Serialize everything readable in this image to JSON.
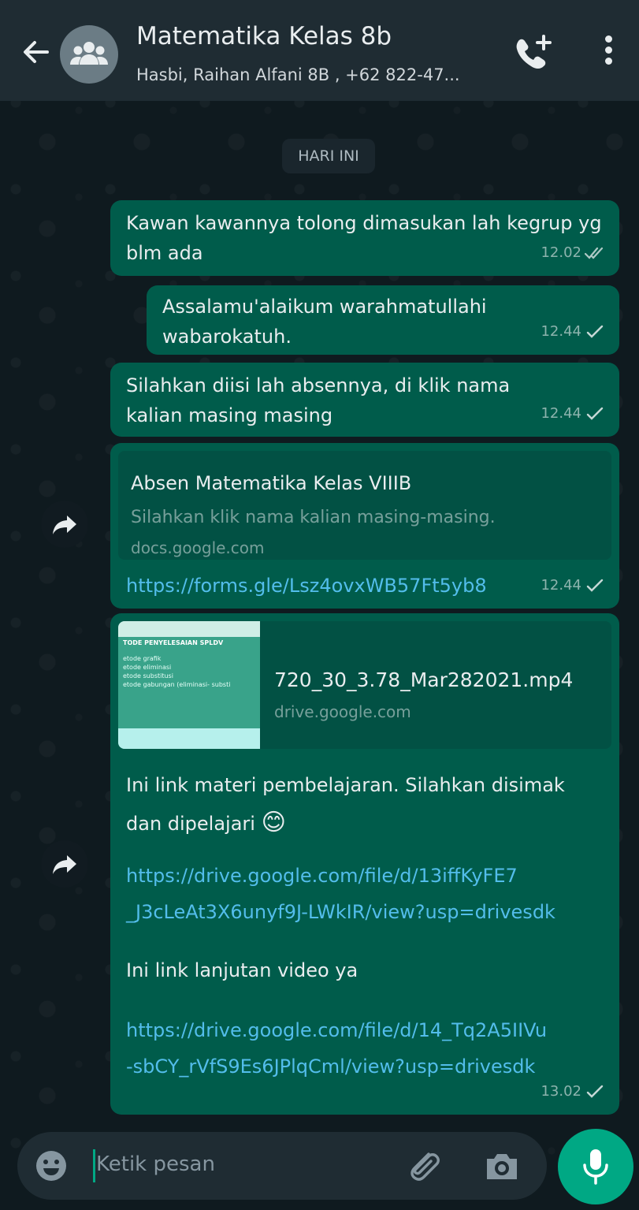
{
  "header": {
    "title": "Matematika Kelas 8b",
    "subtitle": "Hasbi, Raihan Alfani 8B , +62 822-47..."
  },
  "date_divider": "HARI INI",
  "messages": [
    {
      "text": "Kawan kawannya tolong dimasukan lah kegrup yg blm ada",
      "time": "12.02",
      "status": "read"
    },
    {
      "text": "Assalamu'alaikum warahmatullahi wabarokatuh.",
      "time": "12.44",
      "status": "sent"
    },
    {
      "text": "Silahkan diisi lah absennya, di klik nama kalian masing masing",
      "time": "12.44",
      "status": "sent"
    },
    {
      "preview_title": "Absen Matematika Kelas VIIIB",
      "preview_desc": "Silahkan klik nama kalian masing-masing.",
      "preview_domain": "docs.google.com",
      "link": "https://forms.gle/Lsz4ovxWB57Ft5yb8",
      "time": "12.44",
      "status": "sent"
    },
    {
      "file_name": "720_30_3.78_Mar282021.mp4",
      "file_domain": "drive.google.com",
      "thumb_heading": "TODE PENYELESAIAN SPLDV",
      "thumb_lines": [
        "etode grafik",
        "etode eliminasi",
        "etode substitusi",
        "etode gabungan (eliminasi- substi"
      ],
      "body1": "Ini link materi pembelajaran. Silahkan disimak dan dipelajari",
      "emoji": "😊",
      "link1_line1": "https://drive.google.com/file/d/13iffKyFE7",
      "link1_line2": "_J3cLeAt3X6unyf9J-LWkIR/view?usp=drivesdk",
      "body2": "Ini link lanjutan video ya",
      "link2_line1": "https://drive.google.com/file/d/14_Tq2A5IIVu",
      "link2_line2": "-sbCY_rVfS9Es6JPlqCml/view?usp=drivesdk",
      "time": "13.02",
      "status": "sent"
    }
  ],
  "composer": {
    "placeholder": "Ketik pesan"
  },
  "colors": {
    "outgoing_bubble": "#005c4b",
    "header": "#1f2c33",
    "accent": "#00a884",
    "link": "#53bdeb"
  },
  "icons": [
    "back-arrow-icon",
    "group-avatar-icon",
    "add-call-icon",
    "more-vert-icon",
    "forward-icon",
    "emoji-icon",
    "attach-icon",
    "camera-icon",
    "mic-icon",
    "double-check-icon",
    "single-check-icon"
  ]
}
